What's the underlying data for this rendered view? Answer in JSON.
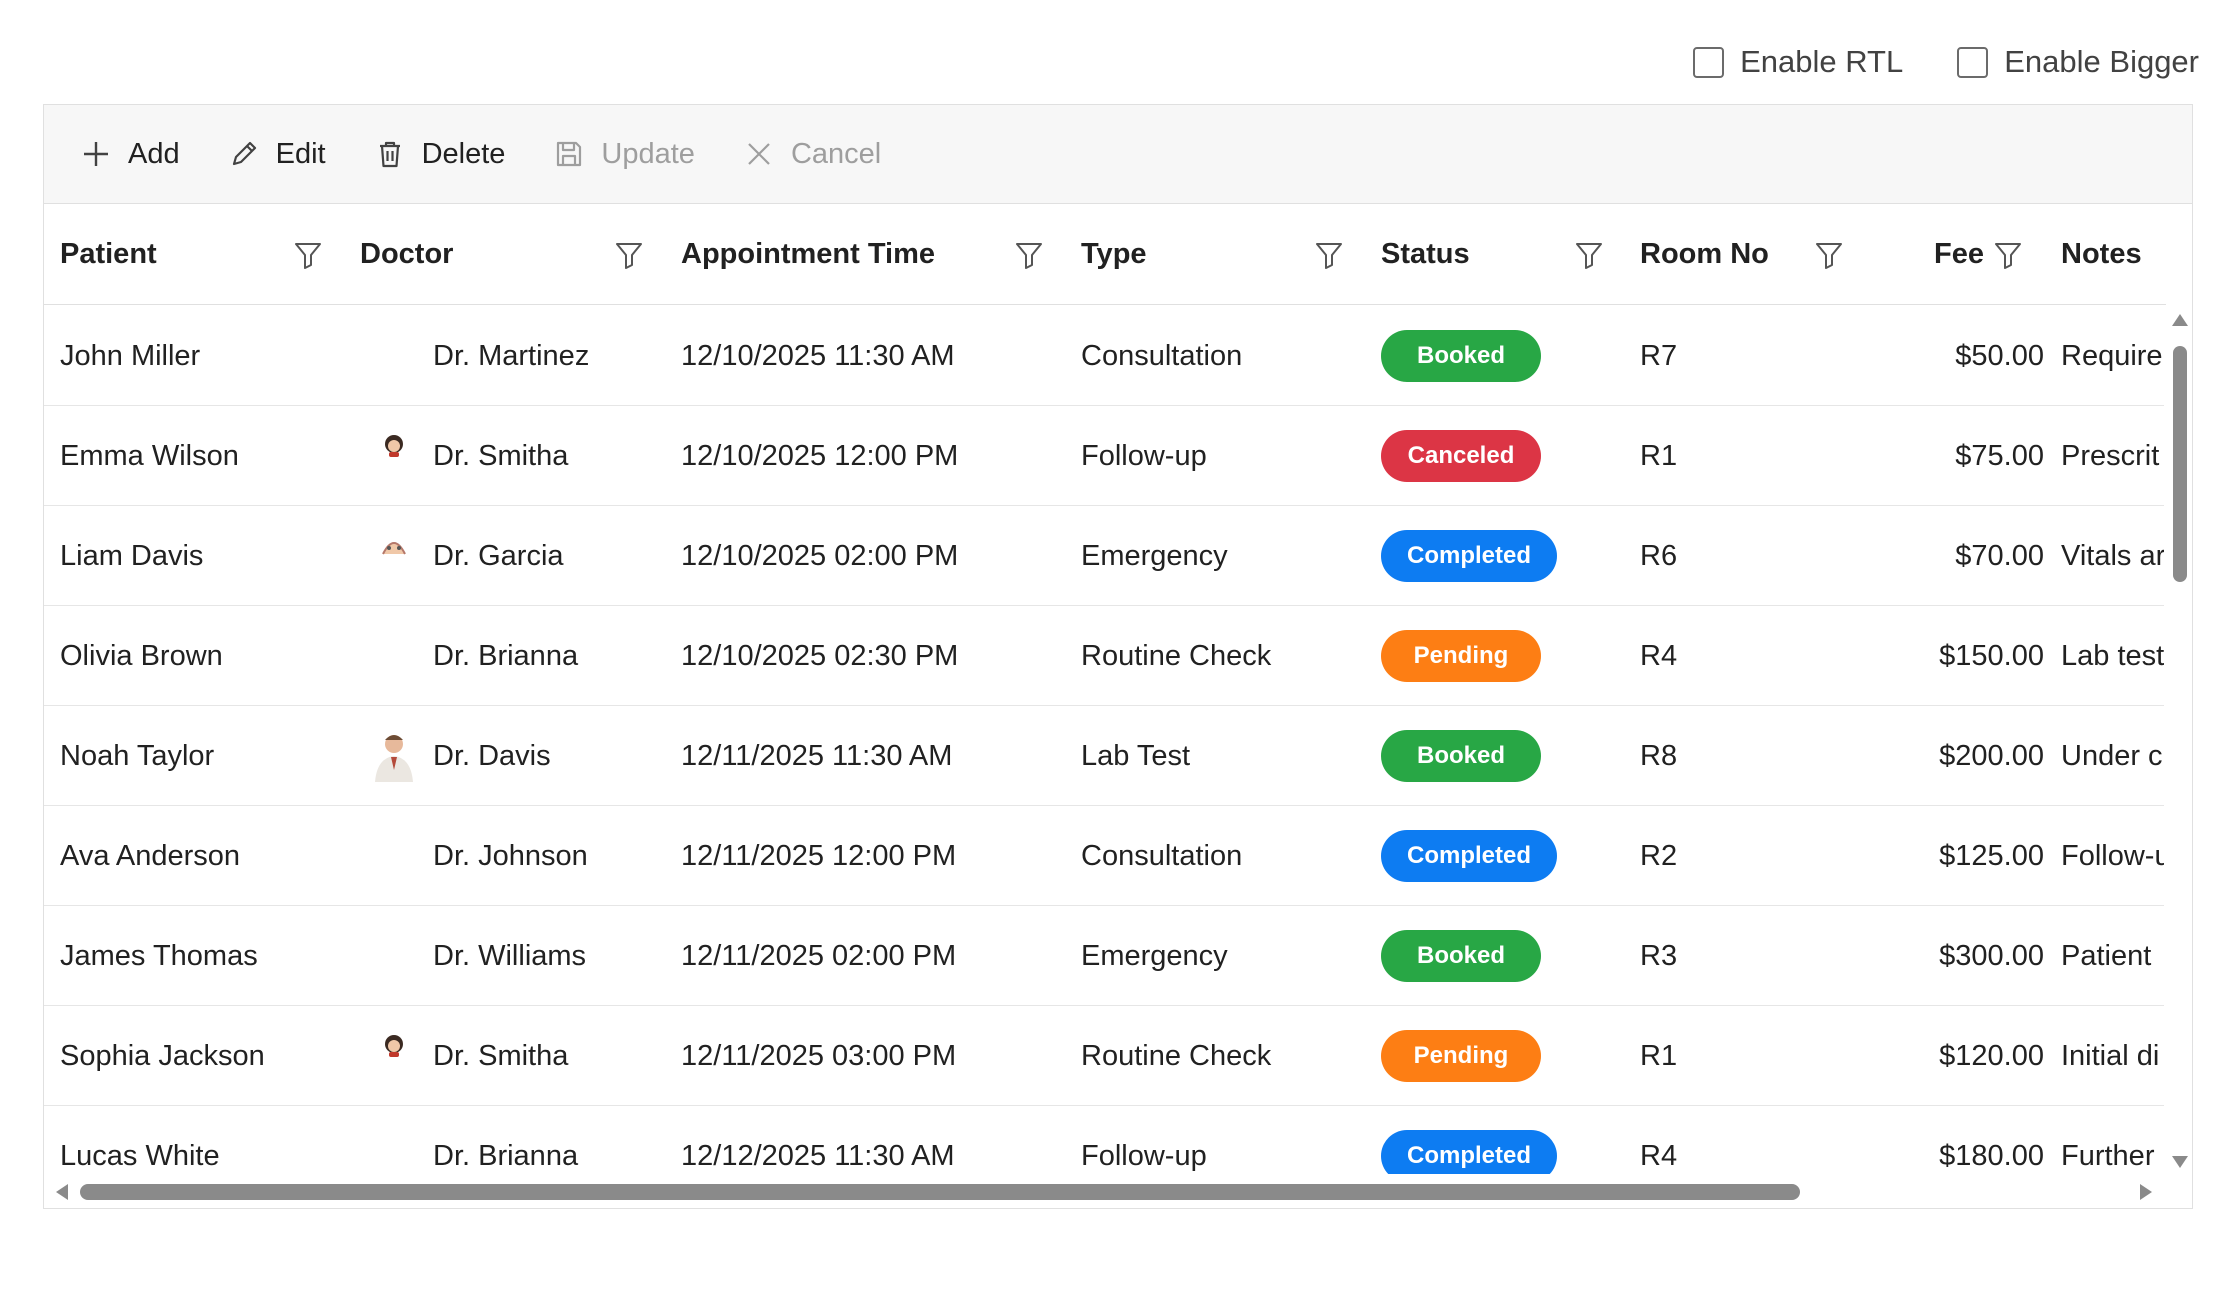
{
  "options": {
    "rtl_label": "Enable RTL",
    "bigger_label": "Enable Bigger"
  },
  "toolbar": {
    "add": "Add",
    "edit": "Edit",
    "delete": "Delete",
    "update": "Update",
    "cancel": "Cancel"
  },
  "columns": [
    "Patient",
    "Doctor",
    "Appointment Time",
    "Type",
    "Status",
    "Room No",
    "Fee",
    "Notes"
  ],
  "rows": [
    {
      "patient": "John Miller",
      "doctor": "Dr. Martinez",
      "time": "12/10/2025 11:30 AM",
      "type": "Consultation",
      "status": "Booked",
      "room": "R7",
      "fee": "$50.00",
      "notes": "Require"
    },
    {
      "patient": "Emma Wilson",
      "doctor": "Dr. Smitha",
      "time": "12/10/2025 12:00 PM",
      "type": "Follow-up",
      "status": "Canceled",
      "room": "R1",
      "fee": "$75.00",
      "notes": "Prescrit"
    },
    {
      "patient": "Liam Davis",
      "doctor": "Dr. Garcia",
      "time": "12/10/2025 02:00 PM",
      "type": "Emergency",
      "status": "Completed",
      "room": "R6",
      "fee": "$70.00",
      "notes": "Vitals ar"
    },
    {
      "patient": "Olivia Brown",
      "doctor": "Dr. Brianna",
      "time": "12/10/2025 02:30 PM",
      "type": "Routine Check",
      "status": "Pending",
      "room": "R4",
      "fee": "$150.00",
      "notes": "Lab test"
    },
    {
      "patient": "Noah Taylor",
      "doctor": "Dr. Davis",
      "time": "12/11/2025 11:30 AM",
      "type": "Lab Test",
      "status": "Booked",
      "room": "R8",
      "fee": "$200.00",
      "notes": "Under c"
    },
    {
      "patient": "Ava Anderson",
      "doctor": "Dr. Johnson",
      "time": "12/11/2025 12:00 PM",
      "type": "Consultation",
      "status": "Completed",
      "room": "R2",
      "fee": "$125.00",
      "notes": "Follow-u"
    },
    {
      "patient": "James Thomas",
      "doctor": "Dr. Williams",
      "time": "12/11/2025 02:00 PM",
      "type": "Emergency",
      "status": "Booked",
      "room": "R3",
      "fee": "$300.00",
      "notes": "Patient"
    },
    {
      "patient": "Sophia Jackson",
      "doctor": "Dr. Smitha",
      "time": "12/11/2025 03:00 PM",
      "type": "Routine Check",
      "status": "Pending",
      "room": "R1",
      "fee": "$120.00",
      "notes": "Initial di"
    },
    {
      "patient": "Lucas White",
      "doctor": "Dr. Brianna",
      "time": "12/12/2025 11:30 AM",
      "type": "Follow-up",
      "status": "Completed",
      "room": "R4",
      "fee": "$180.00",
      "notes": "Further"
    }
  ],
  "avatars": {
    "Dr. Smitha": "female-doctor-avatar",
    "Dr. Garcia": "doctor-avatar",
    "Dr. Davis": "male-doctor-avatar"
  },
  "status_colors": {
    "Booked": "#28a745",
    "Canceled": "#dc3545",
    "Completed": "#0d7cf2",
    "Pending": "#fd7e14"
  }
}
